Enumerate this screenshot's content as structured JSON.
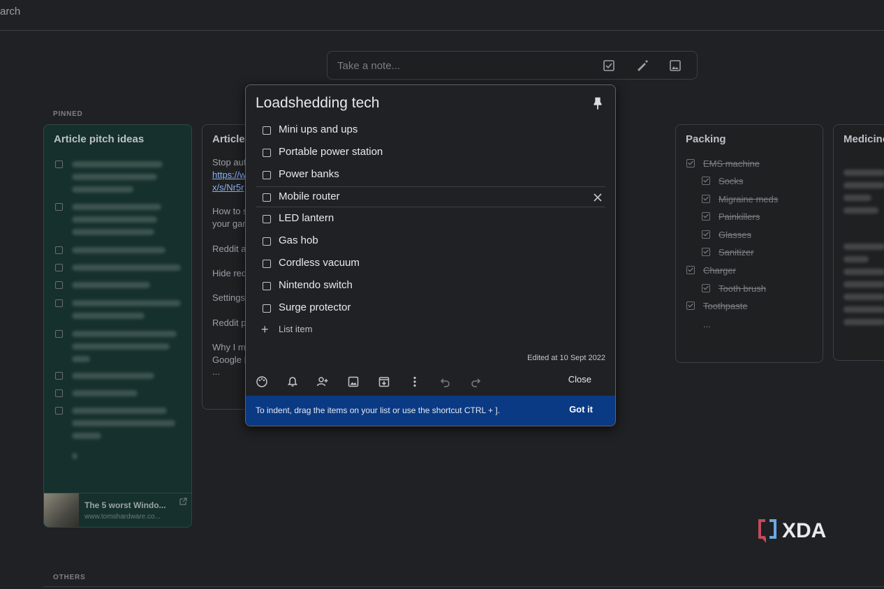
{
  "topbar": {
    "search_fragment": "arch"
  },
  "take_note": {
    "placeholder": "Take a note...",
    "icons": [
      "new-list-icon",
      "drawing-icon",
      "image-icon"
    ]
  },
  "sections": {
    "pinned": "PINNED",
    "others": "OTHERS"
  },
  "cards": {
    "article_pitch": {
      "title": "Article pitch ideas",
      "link_title": "The 5 worst Windo...",
      "link_url": "www.tomshardware.co..."
    },
    "article": {
      "title": "Article",
      "lines": [
        "Stop aut",
        "https://w",
        "x/s/Nr5r",
        "How to s",
        "your gar",
        "Reddit ac",
        "Hide red",
        "Settings",
        "Reddit pr",
        "Why I mo",
        "Google H",
        "..."
      ]
    },
    "packing": {
      "title": "Packing",
      "items": [
        {
          "label": "EMS machine",
          "indent": false
        },
        {
          "label": "Socks",
          "indent": true
        },
        {
          "label": "Migraine meds",
          "indent": true
        },
        {
          "label": "Painkillers",
          "indent": true
        },
        {
          "label": "Glasses",
          "indent": true
        },
        {
          "label": "Sanitizer",
          "indent": true
        },
        {
          "label": "Charger",
          "indent": false
        },
        {
          "label": "Tooth brush",
          "indent": true
        },
        {
          "label": "Toothpaste",
          "indent": false
        }
      ],
      "more": "..."
    },
    "medicine": {
      "title": "Medicine"
    }
  },
  "modal": {
    "title": "Loadshedding tech",
    "items": [
      "Mini ups and ups",
      "Portable power station",
      "Power banks",
      "Mobile router",
      "LED lantern",
      "Gas hob",
      "Cordless vacuum",
      "Nintendo switch",
      "Surge protector"
    ],
    "add_item": "List item",
    "edited": "Edited at 10 Sept 2022",
    "close": "Close",
    "banner_text": "To indent, drag the items on your list or use the shortcut CTRL + ].",
    "banner_button": "Got it"
  },
  "watermark": "XDA"
}
